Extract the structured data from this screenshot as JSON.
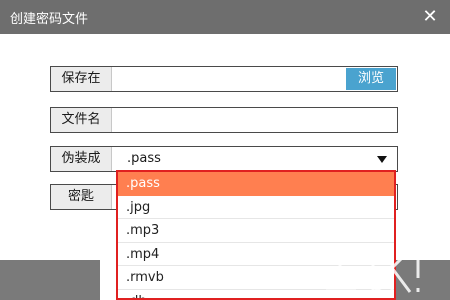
{
  "window": {
    "title": "创建密码文件"
  },
  "form": {
    "save_location_label": "保存在",
    "save_location_value": "",
    "browse_label": "浏览",
    "filename_label": "文件名",
    "filename_value": "",
    "disguise_label": "伪装成",
    "disguise_value": ".pass",
    "key_label": "密匙"
  },
  "dropdown": {
    "options": [
      ".pass",
      ".jpg",
      ".mp3",
      ".mp4",
      ".rmvb",
      ".db"
    ],
    "selected_index": 0
  },
  "colors": {
    "titlebar": "#6e6e6e",
    "browse_button": "#4aa3cf",
    "dropdown_border": "#e02020",
    "selected_option": "#ff7f50"
  },
  "icons": {
    "close": "close-icon",
    "dropdown_arrow": "triangle-down-icon",
    "watermark": "watermark-logo"
  }
}
